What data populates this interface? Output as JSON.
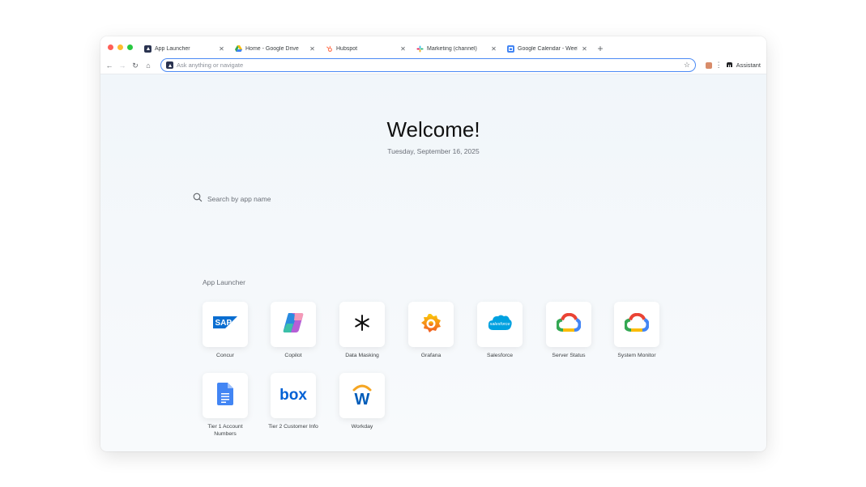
{
  "tabs": [
    {
      "title": "App Launcher",
      "icon": "app-launcher-icon",
      "active": true
    },
    {
      "title": "Home - Google Drive",
      "icon": "google-drive-icon"
    },
    {
      "title": "Hubspot",
      "icon": "hubspot-icon"
    },
    {
      "title": "Marketing (channel)",
      "icon": "slack-icon"
    },
    {
      "title": "Google Calendar - Week of",
      "icon": "google-calendar-icon"
    }
  ],
  "omnibox": {
    "placeholder": "Ask anything or navigate"
  },
  "toolbar": {
    "assistant_label": "Assistant"
  },
  "page": {
    "welcome": "Welcome!",
    "date": "Tuesday, September 16, 2025",
    "search_placeholder": "Search by app name",
    "section_label": "App Launcher"
  },
  "apps": [
    {
      "name": "Concur",
      "icon": "sap-icon",
      "logo_text": "SAP"
    },
    {
      "name": "Copilot",
      "icon": "copilot-icon"
    },
    {
      "name": "Data Masking",
      "icon": "asterisk-icon"
    },
    {
      "name": "Grafana",
      "icon": "grafana-icon"
    },
    {
      "name": "Salesforce",
      "icon": "salesforce-icon",
      "logo_text": "salesforce"
    },
    {
      "name": "Server Status",
      "icon": "google-cloud-icon"
    },
    {
      "name": "System Monitor",
      "icon": "google-cloud-icon"
    },
    {
      "name": "Tier 1 Account Numbers",
      "icon": "google-docs-icon"
    },
    {
      "name": "Tier 2 Customer Info",
      "icon": "box-icon",
      "logo_text": "box"
    },
    {
      "name": "Workday",
      "icon": "workday-icon",
      "logo_text": "W"
    }
  ],
  "colors": {
    "accent": "#4c8bf5",
    "close": "#ff5f57",
    "minimize": "#febc2e",
    "zoom": "#28c840"
  }
}
